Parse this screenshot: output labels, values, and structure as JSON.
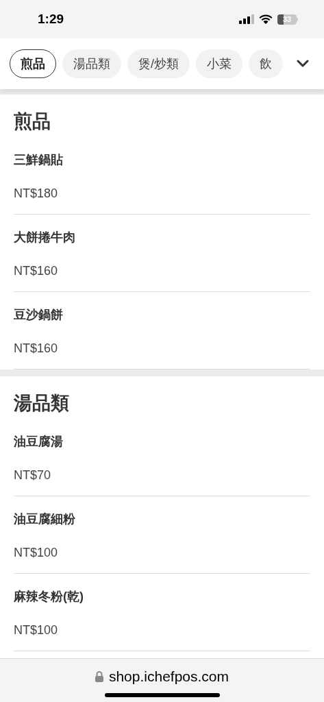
{
  "status_bar": {
    "time": "1:29",
    "battery": "33"
  },
  "category_tabs": [
    {
      "label": "煎品",
      "selected": true
    },
    {
      "label": "湯品類",
      "selected": false
    },
    {
      "label": "煲/炒類",
      "selected": false
    },
    {
      "label": "小菜",
      "selected": false
    },
    {
      "label": "飲",
      "selected": false
    }
  ],
  "sections": [
    {
      "title": "煎品",
      "items": [
        {
          "name": "三鮮鍋貼",
          "price": "NT$180"
        },
        {
          "name": "大餅捲牛肉",
          "price": "NT$160"
        },
        {
          "name": "豆沙鍋餅",
          "price": "NT$160"
        }
      ]
    },
    {
      "title": "湯品類",
      "items": [
        {
          "name": "油豆腐湯",
          "price": "NT$70"
        },
        {
          "name": "油豆腐細粉",
          "price": "NT$100"
        },
        {
          "name": "麻辣冬粉(乾)",
          "price": "NT$100"
        }
      ]
    }
  ],
  "address_bar": {
    "url": "shop.ichefpos.com"
  }
}
